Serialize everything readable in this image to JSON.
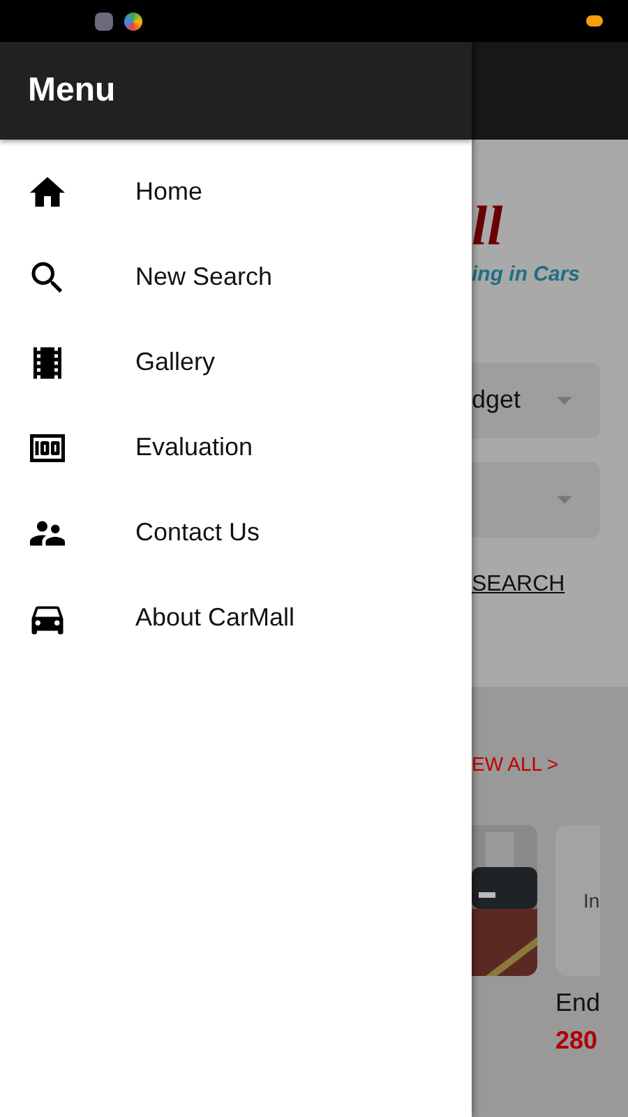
{
  "drawer": {
    "title": "Menu",
    "items": [
      {
        "kind": "home",
        "label": "Home"
      },
      {
        "kind": "search",
        "label": "New Search"
      },
      {
        "kind": "film",
        "label": "Gallery"
      },
      {
        "kind": "money",
        "label": "Evaluation"
      },
      {
        "kind": "people",
        "label": "Contact Us"
      },
      {
        "kind": "car",
        "label": "About CarMall"
      }
    ]
  },
  "background": {
    "logo_text": "ll",
    "tagline": "ing in Cars",
    "dropdown_text": "dget",
    "search_link": "SEARCH",
    "view_all": "EW ALL >",
    "card_placeholder": "In",
    "card_title": "End",
    "card_price": "280"
  }
}
